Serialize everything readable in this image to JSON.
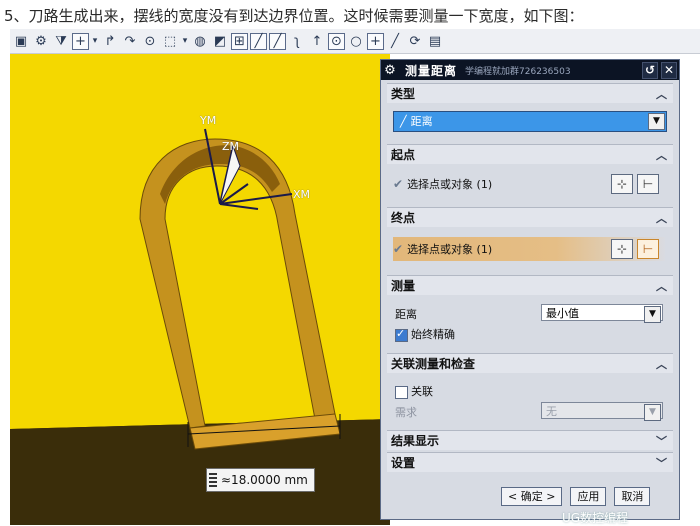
{
  "caption": "5、刀路生成出来，摆线的宽度没有到达边界位置。这时候需要测量一下宽度，如下图：",
  "toolbar": {
    "icons": [
      "snap-icon",
      "gear-icon",
      "filter-icon",
      "point-icon",
      "arrow-icon",
      "rotate-icon",
      "circle-icon",
      "square-icon",
      "shade-icon",
      "cube-icon",
      "grid-icon",
      "line-icon",
      "slash-icon",
      "curve-icon",
      "up-arrow-icon",
      "circle-point-icon",
      "circle-icon",
      "plus-icon",
      "diagonal-icon",
      "magnet-icon",
      "book-icon"
    ]
  },
  "viewport": {
    "axes": {
      "y": "YM",
      "z": "ZM",
      "x": "XM"
    },
    "dimension": "≈18.0000 mm",
    "colors": {
      "sheet": "#f4d800",
      "floor": "#3a2d0a",
      "wall": "#b98a22"
    }
  },
  "dialog": {
    "title": "测量距离",
    "title_watermark": "学编程就加群726236503",
    "sections": {
      "type": {
        "header": "类型",
        "value": "距离"
      },
      "start": {
        "header": "起点",
        "select_label": "选择点或对象 (1)"
      },
      "end": {
        "header": "终点",
        "select_label": "选择点或对象 (1)"
      },
      "measure": {
        "header": "测量",
        "distance_label": "距离",
        "distance_value": "最小值",
        "accurate_label": "始终精确",
        "accurate_checked": true
      },
      "assoc": {
        "header": "关联测量和检查",
        "assoc_label": "关联",
        "assoc_checked": false,
        "require_label": "需求",
        "require_value": "无"
      },
      "result": {
        "header": "结果显示"
      },
      "settings": {
        "header": "设置"
      }
    },
    "buttons": {
      "ok": "< 确定 >",
      "apply": "应用",
      "cancel": "取消"
    }
  },
  "watermark": "UG数控编程"
}
